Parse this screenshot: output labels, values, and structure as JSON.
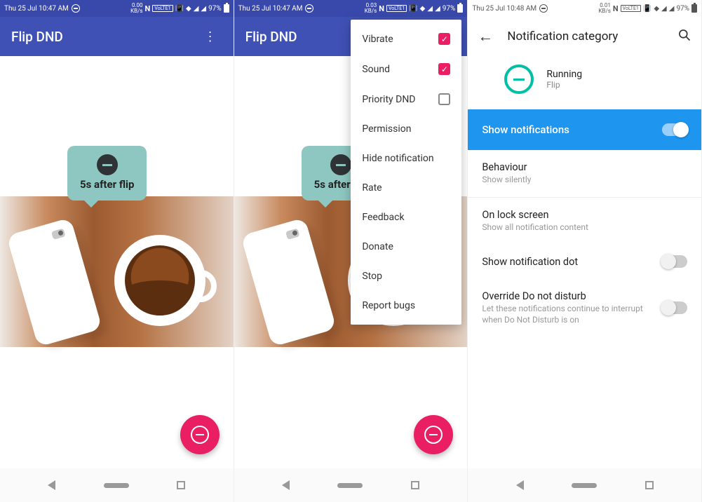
{
  "statusbar": {
    "time_a": "Thu 25 Jul 10:47 AM",
    "time_b": "Thu 25 Jul 10:47 AM",
    "time_c": "Thu 25 Jul 10:48 AM",
    "data_a": "0.00",
    "data_b": "0.03",
    "data_c": "0.01",
    "data_unit": "KB/s",
    "nfc": "N",
    "volte": "VoLTE1",
    "battery": "97%"
  },
  "app": {
    "title": "Flip DND",
    "tooltip": "5s after flip"
  },
  "menu": {
    "vibrate": "Vibrate",
    "sound": "Sound",
    "priority": "Priority DND",
    "permission": "Permission",
    "hide": "Hide notification",
    "rate": "Rate",
    "feedback": "Feedback",
    "donate": "Donate",
    "stop": "Stop",
    "report": "Report bugs"
  },
  "settings": {
    "header": "Notification category",
    "running": "Running",
    "flip": "Flip",
    "show_notifs": "Show notifications",
    "behaviour": "Behaviour",
    "behaviour_sub": "Show silently",
    "lock": "On lock screen",
    "lock_sub": "Show all notification content",
    "dot": "Show notification dot",
    "override": "Override Do not disturb",
    "override_sub": "Let these notifications continue to interrupt when Do Not Disturb is on"
  }
}
